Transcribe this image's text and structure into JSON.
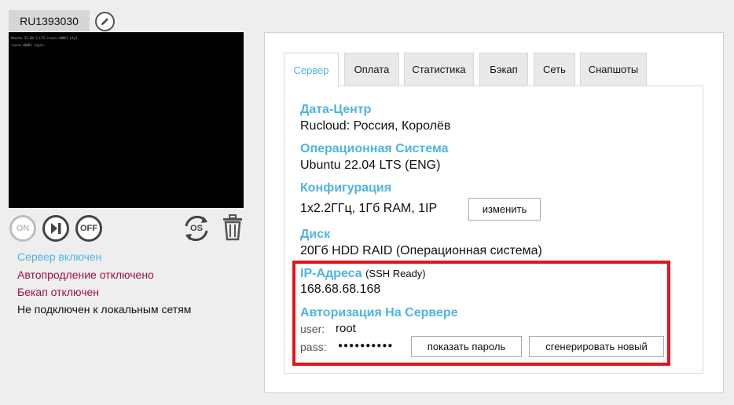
{
  "server": {
    "id": "RU1393030",
    "console_lines": [
      "Ubuntu 22.04.3 LTS rucnn-s0001 tty1",
      "rucnn-s0001 login:"
    ]
  },
  "controls": {
    "on_label": "ON",
    "off_label": "OFF",
    "os_label": "OS"
  },
  "status": {
    "server_on": "Сервер включен",
    "autorenew": "Автопродление отключено",
    "backup": "Бекап отключен",
    "network": "Не подключен к локальным сетям"
  },
  "tabs": [
    {
      "label": "Сервер",
      "active": true
    },
    {
      "label": "Оплата"
    },
    {
      "label": "Статистика"
    },
    {
      "label": "Бэкап"
    },
    {
      "label": "Сеть"
    },
    {
      "label": "Снапшоты"
    }
  ],
  "details": {
    "datacenter_label": "Дата-Центр",
    "datacenter_value": "Rucloud: Россия, Королёв",
    "os_label": "Операционная Система",
    "os_value": "Ubuntu 22.04 LTS (ENG)",
    "config_label": "Конфигурация",
    "config_value": "1x2.2ГГц, 1Гб RAM, 1IP",
    "change_button": "изменить",
    "disk_label": "Диск",
    "disk_value": "20Гб HDD RAID (Операционная система)",
    "ip_label": "IP-Адреса",
    "ip_note": "(SSH Ready)",
    "ip_value": "168.68.68.168",
    "auth_label": "Авторизация На Сервере",
    "user_label": "user:",
    "user_value": "root",
    "pass_label": "pass:",
    "pass_value": "●●●●●●●●●●",
    "show_password_button": "показать пароль",
    "generate_button": "сгенерировать новый"
  },
  "colors": {
    "accent": "#4fb4e2",
    "warning": "#a0103a",
    "highlight": "#e3131b"
  }
}
